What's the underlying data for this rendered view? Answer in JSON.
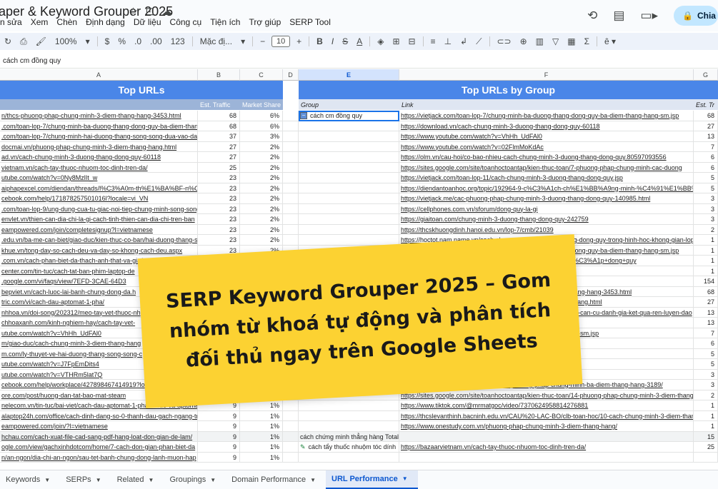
{
  "window": {
    "title": "aper & Keyword Grouper 2025",
    "share_label": "Chia"
  },
  "menus": [
    "n sửa",
    "Xem",
    "Chèn",
    "Định dạng",
    "Dữ liệu",
    "Công cụ",
    "Tiện ích",
    "Trợ giúp",
    "SERP Tool"
  ],
  "toolbar": {
    "zoom": "100%",
    "currency": "$",
    "percent": "%",
    "decimals_dec": ".0",
    "decimals_inc": ".00",
    "number_format": "123",
    "font_name": "Mặc đị...",
    "font_size": "10",
    "minus": "−",
    "plus": "+",
    "bold": "B",
    "italic": "I",
    "strike": "S",
    "text_color": "A",
    "sum": "Σ"
  },
  "formula_bar": {
    "value": "cách cm đồng quy"
  },
  "columns": [
    "A",
    "B",
    "C",
    "D",
    "E",
    "F",
    "G"
  ],
  "left_table": {
    "banner": "Top URLs",
    "headers": [
      "",
      "Est. Traffic",
      "Market Share"
    ],
    "rows": [
      [
        "n/thcs-phuong-phap-chung-minh-3-diem-thang-hang-3453.html",
        "68",
        "6%"
      ],
      [
        ".com/toan-lop-7/chung-minh-ba-duong-thang-dong-quy-ba-diem-thang-hang-sm.jsp",
        "68",
        "6%"
      ],
      [
        ".com/toan-lop-7/chung-minh-hai-duong-thang-song-song-dua-vao-dau-hieu",
        "37",
        "3%"
      ],
      [
        "docmai.vn/phuong-phap-chung-minh-3-diem-thang-hang.html",
        "27",
        "2%"
      ],
      [
        "ad.vn/cach-chung-minh-3-duong-thang-dong-quy-60118",
        "27",
        "2%"
      ],
      [
        "vietnam.vn/cach-tay-thuoc-nhuom-toc-dinh-tren-da/",
        "25",
        "2%"
      ],
      [
        "utube.com/watch?v=0Ny8MzlIt_w",
        "23",
        "2%"
      ],
      [
        "aiphapexcel.com/diendan/threads/l%C3%A0m-th%E1%BA%BF-n%C3%A0o",
        "23",
        "2%"
      ],
      [
        "cebook.com/help/171878257501016l?locale=vi_VN",
        "23",
        "2%"
      ],
      [
        ".com/toan-lop-9/ung-dung-cua-tu-giac-noi-tiep-chung-minh-song-song",
        "23",
        "2%"
      ],
      [
        "envlet.vn/thien-can-dia-chi-la-gi-cach-tinh-thien-can-dia-chi-tren-ban",
        "23",
        "2%"
      ],
      [
        "eampowered.com/join/completesignup?l=vietnamese",
        "23",
        "2%"
      ],
      [
        ".edu.vn/ba-me-can-biet/giao-duc/kien-thuc-co-ban/hai-duong-thang-song",
        "23",
        "2%"
      ],
      [
        "khue.vn/tong-day-so-cach-deu-va-day-so-khong-cach-deu.aspx",
        "23",
        "2%"
      ],
      [
        ".com.vn/cach-phan-biet-da-thach-anh-that-va-gia/",
        "",
        ""
      ],
      [
        "center.com/tin-tuc/cach-tat-ban-phim-laptop-de",
        "",
        ""
      ],
      [
        ".google.com/vi/faqs/view/7EFD-3CAE-64D3",
        "",
        ""
      ],
      [
        "bepviet.vn/cach-luoc-lai-banh-chung-dong-da.h",
        "",
        ""
      ],
      [
        "tric.com/vi/cach-dau-aptomat-1-pha/",
        "",
        ""
      ],
      [
        "nhhoa.vn/doi-song/202312/meo-tay-vet-thuoc-nh",
        "",
        ""
      ],
      [
        "chhoaxanh.com/kinh-nghiem-hay/cach-tay-vet-",
        "",
        ""
      ],
      [
        "utube.com/watch?v=VhHh_UdFAl0",
        "",
        ""
      ],
      [
        "m/giao-duc/cach-chung-minh-3-diem-thang-hang",
        "",
        ""
      ],
      [
        "m.com/ly-thuyet-ve-hai-duong-thang-song-song-c",
        "",
        ""
      ],
      [
        "utube.com/watch?v=J7FpEmDits4",
        "",
        ""
      ],
      [
        "utube.com/watch?v=VTHRm5lat7Q",
        "",
        ""
      ],
      [
        "cebook.com/help/workplace/427898467414919?lo",
        "",
        ""
      ],
      [
        "ore.com/post/huong-dan-tat-bao-mat-steam",
        "",
        "1%"
      ],
      [
        "nelecom.vn/tin-tuc/bai-viet/cach-dau-aptomat-1-pha-1-cuc-va-aptomat",
        "9",
        "1%"
      ],
      [
        "alaptop24h.com/office/cach-dinh-dang-so-0-thanh-dau-gach-ngang-tren",
        "9",
        "1%"
      ],
      [
        "eampowered.com/join/?l=vietnamese",
        "9",
        "1%"
      ],
      [
        "hchau.com/cach-xuat-file-cad-sang-pdf-hang-loat-don-gian-de-lam/",
        "9",
        "1%"
      ],
      [
        "ogle.com/view/gachxinhdotcom/home/7-cach-don-gian-phan-biet-da",
        "9",
        "1%"
      ],
      [
        "n/an-ngon/dia-chi-an-ngon/sau-tet-banh-chung-dong-lanh-muon-hap",
        "9",
        "1%"
      ]
    ]
  },
  "right_table": {
    "banner": "Top URLs by Group",
    "headers": [
      "Group",
      "Link",
      "Est. Tr"
    ],
    "group_name": "cách cm đồng quy",
    "rows": [
      [
        "https://vietjack.com/toan-lop-7/chung-minh-ba-duong-thang-dong-quy-ba-diem-thang-hang-sm.jsp",
        "68"
      ],
      [
        "https://download.vn/cach-chung-minh-3-duong-thang-dong-quy-60118",
        "27"
      ],
      [
        "https://www.youtube.com/watch?v=VhHh_UdFAl0",
        "13"
      ],
      [
        "https://www.youtube.com/watch?v=02FlmMoKdAc",
        "7"
      ],
      [
        "https://olm.vn/cau-hoi/co-bao-nhieu-cach-chung-minh-3-duong-thang-dong-quy.80597093556",
        "6"
      ],
      [
        "https://sites.google.com/site/toanhoctoantap/kien-thuc-toan/7-phuong-phap-chung-minh-cac-duong",
        "6"
      ],
      [
        "https://vietjack.com/toan-lop-11/cach-chung-minh-3-duong-thang-dong-quy.jsp",
        "5"
      ],
      [
        "https://diendantoanhoc.org/topic/192964-9-c%C3%A1ch-ch%E1%BB%A9ng-minh-%C4%91%E1%BB%93ng",
        "5"
      ],
      [
        "https://vietjack.me/cac-phuong-phap-chung-minh-3-duong-thang-dong-quy-140985.html",
        "3"
      ],
      [
        "https://cellphones.com.vn/sforum/dong-quy-la-gi",
        "3"
      ],
      [
        "https://giaitoan.com/chung-minh-3-duong-thang-dong-quy-242759",
        "3"
      ],
      [
        "https://thcskhuongdinh.hanoi.edu.vn/lop-7/cmb/21039",
        "2"
      ],
      [
        "https://hoctot.nam.name.vn/cach-chung-minh-ba-duong-thang-dong-quy-trong-hinh-hoc-khong-gian-lop",
        "1"
      ],
      [
        "https://vietjack.com/toan-lop-7/chung-minh-ba-duong-thang-dong-quy-ba-diem-thang-hang-sm.jsp",
        "1"
      ],
      [
        "https://vietjack.com/%C3%AAu+ph%C6%B0%C6%A1ng+ph%C3%A1p+dong+quy",
        "1"
      ],
      [
        "",
        "1"
      ],
      [
        "",
        "154"
      ],
      [
        "https://vietjack.com/thcs-phuong-phap-chung-minh-3-diem-thang-hang-3453.html",
        "68"
      ],
      [
        "https://download.vn/phuong-phap-chung-minh-3-diem-thang-hang.html",
        "27"
      ],
      [
        "https://vietjack.com/toan-lop-7/chung-minh-3-diem-thang-hang-can-cu-danh-gia-ket-qua-ren-luyen-dao",
        "13"
      ],
      [
        "",
        "13"
      ],
      [
        "https://vietjack.com/toan-lop-7/chung-minh-3-diem-thang-hang-sm.jsp",
        "7"
      ],
      [
        "",
        "6"
      ],
      [
        "",
        "5"
      ],
      [
        "",
        "5"
      ],
      [
        "",
        "3"
      ],
      [
        "https://sskn.vn/sang-kien-kinh-nghiem-phuong-phap-chung-minh-ba-diem-thang-hang-3189/",
        "3"
      ],
      [
        "https://sites.google.com/site/toanhoctoantap/kien-thuc-toan/14-phuong-phap-chung-minh-3-diem-thang",
        "2"
      ],
      [
        "https://www.tiktok.com/@mrmatgoc/video/7370624958814276881",
        "1"
      ],
      [
        "https://thcslevanthinh.bacninh.edu.vn/CAU%20-LAC-BO/clb-toan-hoc/10-cach-chung-minh-3-diem-thang",
        "1"
      ],
      [
        "https://www.onestudy.com.vn/phuong-phap-chung-minh-3-diem-thang-hang/",
        "1"
      ],
      [
        "",
        "15"
      ],
      [
        "https://bazaarvietnam.vn/cach-tay-thuoc-nhuom-toc-dinh-tren-da/",
        "25"
      ],
      [
        "",
        ""
      ]
    ],
    "total_label": "cách chứng minh thẳng hàng Total",
    "total_value": "15",
    "next_group": "cách tẩy thuốc nhuộm tóc dính"
  },
  "overlay": {
    "text": "SERP Keyword Grouper 2025 – Gom nhóm từ khoá tự động và phân tích đối thủ ngay trên Google Sheets"
  },
  "sheet_tabs": [
    "Keywords",
    "SERPs",
    "Related",
    "Groupings",
    "Domain Performance",
    "URL Performance"
  ],
  "colors": {
    "banner": "#4a86e8",
    "subheader": "#9cb4d8",
    "overlay": "#fcd232",
    "active_tab": "#0b57d0"
  }
}
